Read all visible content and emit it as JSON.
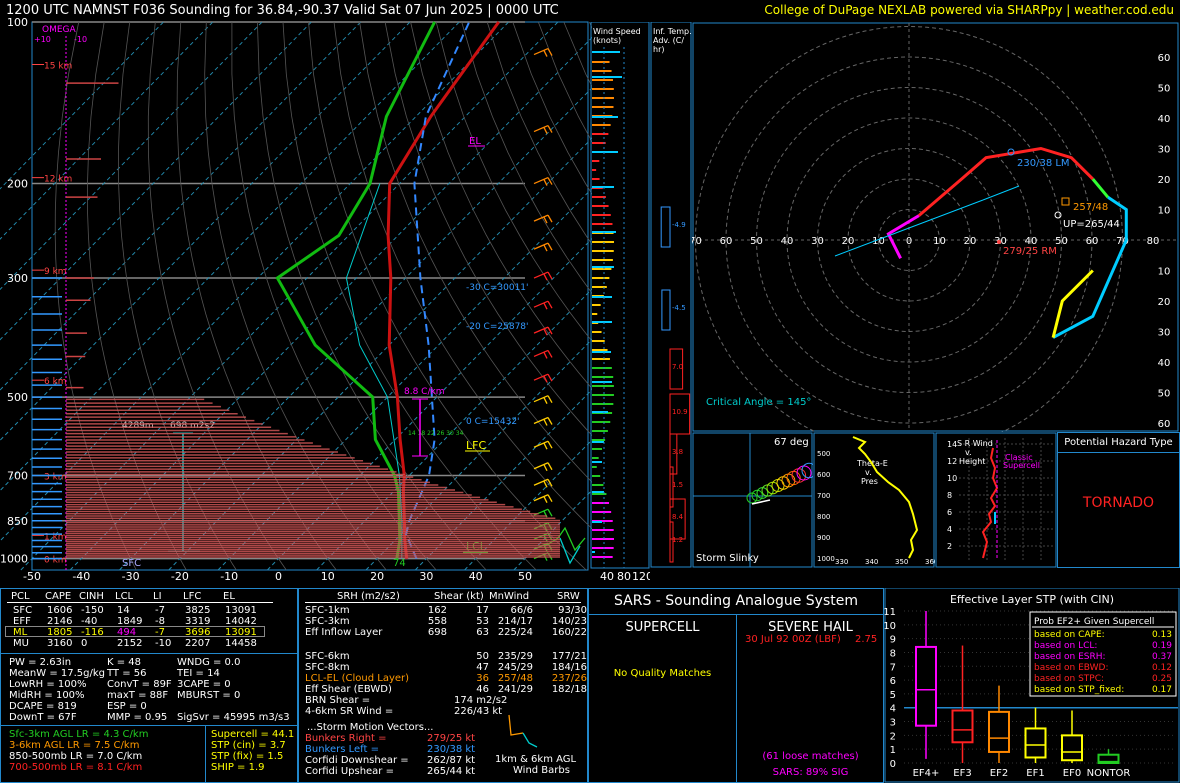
{
  "header": {
    "title": "1200 UTC NAMNST F036 Sounding for 36.84,-90.37 Valid  Sat 07 Jun 2025 | 0000 UTC",
    "credit": "College of DuPage NEXLAB powered via SHARPpy | weather.cod.edu"
  },
  "colors": {
    "accent": "#2288cc",
    "temp": "#cc1111",
    "dewpoint": "#11bb11",
    "parcel": "#3388ff",
    "highlight": "#ffff00",
    "magenta": "#ff00ff"
  },
  "chart_data": [
    {
      "type": "line",
      "name": "skewt",
      "pressure_ticks": [
        "100",
        "200",
        "300",
        "500",
        "700",
        "850",
        "1000"
      ],
      "temp_ticks": [
        "-50",
        "-40",
        "-30",
        "-20",
        "-10",
        "0",
        "10",
        "20",
        "30",
        "40",
        "50"
      ],
      "height_labels": [
        "15 km",
        "12 km",
        "9 km",
        "6 km",
        "3 km",
        "1 km",
        "0 km"
      ],
      "omega_label": "OMEGA",
      "omega_ticks": [
        "+10",
        "-10"
      ],
      "annotations": [
        "EL",
        "LFC",
        "LCL",
        "SFC",
        "74",
        "-30 C=30011'",
        "-20 C=25878'",
        "0 C=15432'",
        "8.8 C/km",
        "4289m",
        "698 m2s2",
        "14  18  22 26 30 34"
      ],
      "series": [
        {
          "name": "Temperature",
          "points": [
            [
              1000,
              26
            ],
            [
              925,
              22
            ],
            [
              850,
              18
            ],
            [
              750,
              12
            ],
            [
              700,
              9
            ],
            [
              600,
              1
            ],
            [
              500,
              -8
            ],
            [
              400,
              -20
            ],
            [
              300,
              -33
            ],
            [
              250,
              -42
            ],
            [
              200,
              -52
            ],
            [
              150,
              -57
            ],
            [
              100,
              -62
            ]
          ]
        },
        {
          "name": "Dewpoint",
          "points": [
            [
              1000,
              24
            ],
            [
              925,
              21
            ],
            [
              850,
              17
            ],
            [
              750,
              11
            ],
            [
              700,
              7
            ],
            [
              600,
              -4
            ],
            [
              500,
              -13
            ],
            [
              400,
              -35
            ],
            [
              300,
              -56
            ],
            [
              250,
              -52
            ],
            [
              200,
              -56
            ],
            [
              150,
              -66
            ],
            [
              100,
              -75
            ]
          ]
        },
        {
          "name": "Parcel",
          "points": [
            [
              1000,
              28
            ],
            [
              900,
              21
            ],
            [
              850,
              19
            ],
            [
              700,
              14
            ],
            [
              600,
              8
            ],
            [
              500,
              -1
            ],
            [
              400,
              -12
            ],
            [
              300,
              -27
            ],
            [
              200,
              -47
            ],
            [
              150,
              -58
            ],
            [
              100,
              -68
            ]
          ]
        }
      ]
    },
    {
      "type": "line",
      "name": "hodograph",
      "rings": [
        "10",
        "20",
        "30",
        "40",
        "50",
        "60",
        "70"
      ],
      "x_ticks": [
        "70",
        "60",
        "50",
        "40",
        "30",
        "20",
        "10",
        "0",
        "10",
        "20",
        "30",
        "40",
        "50",
        "60",
        "70",
        "80"
      ],
      "y_ticks": [
        "60",
        "50",
        "40",
        "30",
        "20",
        "10",
        "0",
        "10",
        "20",
        "30",
        "40",
        "50",
        "60"
      ],
      "labels": {
        "lm": "230/38 LM",
        "rm": "279/25 RM",
        "up": "UP=265/44",
        "cm": "257/48",
        "critical": "Critical Angle = 145°"
      },
      "segments": [
        {
          "color": "#ff00ff",
          "points": [
            [
              -8,
              -6
            ],
            [
              -12,
              2
            ],
            [
              -2,
              8
            ]
          ]
        },
        {
          "color": "#ff2222",
          "points": [
            [
              -2,
              8
            ],
            [
              12,
              20
            ],
            [
              20,
              27
            ],
            [
              38,
              30
            ],
            [
              48,
              27
            ],
            [
              55,
              20
            ]
          ]
        },
        {
          "color": "#33ff33",
          "points": [
            [
              55,
              20
            ],
            [
              60,
              14
            ]
          ]
        },
        {
          "color": "#00ccff",
          "points": [
            [
              60,
              14
            ],
            [
              66,
              10
            ],
            [
              66,
              0
            ],
            [
              55,
              -25
            ],
            [
              42,
              -32
            ]
          ]
        },
        {
          "color": "#ffff00",
          "points": [
            [
              42,
              -32
            ],
            [
              45,
              -20
            ],
            [
              55,
              -10
            ]
          ]
        }
      ]
    }
  ],
  "wind_speed": {
    "title1": "Wind Speed",
    "title2": "(knots)",
    "ticks": [
      "40",
      "80",
      "120"
    ]
  },
  "temp_adv": {
    "title1": "Inf. Temp.",
    "title2": "Adv. (C/",
    "title3": "hr)",
    "values": [
      "-4.9",
      "-4.5",
      "7.0",
      "10.9",
      "3.8",
      "1.5",
      "8.4",
      "1.2"
    ]
  },
  "slinky": {
    "label": "67 deg",
    "title": "Storm Slinky"
  },
  "theta": {
    "title1": "Theta-E",
    "title2": "v.",
    "title3": "Pres",
    "y_ticks": [
      "500",
      "600",
      "700",
      "800",
      "900",
      "1000"
    ],
    "x_ticks": [
      "330",
      "340",
      "350",
      "360"
    ]
  },
  "srwind": {
    "title1": "S R Wind",
    "title2": "v.",
    "title3": "Height",
    "y_ticks": [
      "14",
      "12",
      "10",
      "8",
      "6",
      "4",
      "2"
    ],
    "note1": "Classic",
    "note2": "Supercell"
  },
  "hazard": {
    "title": "Potential Hazard Type",
    "value": "TORNADO"
  },
  "parcels": {
    "headers": [
      "PCL",
      "CAPE",
      "CINH",
      "LCL",
      "LI",
      "LFC",
      "EL"
    ],
    "rows": [
      [
        "SFC",
        "1606",
        "-150",
        "14",
        "-7",
        "3825",
        "13091"
      ],
      [
        "EFF",
        "2146",
        "-40",
        "1849",
        "-8",
        "3319",
        "14042"
      ],
      [
        "ML",
        "1805",
        "-116",
        "494",
        "-7",
        "3696",
        "13091"
      ],
      [
        "MU",
        "3160",
        "0",
        "2152",
        "-10",
        "2207",
        "14458"
      ]
    ],
    "misc": [
      [
        "PW = 2.63in",
        "K = 48",
        "WNDG = 0.0"
      ],
      [
        "MeanW = 17.5g/kg",
        "TT = 56",
        "TEI = 14"
      ],
      [
        "LowRH = 100%",
        "ConvT = 89F",
        "3CAPE = 0"
      ],
      [
        "MidRH = 100%",
        "maxT = 88F",
        "MBURST = 0"
      ],
      [
        "DCAPE = 819",
        "ESP = 0",
        ""
      ],
      [
        "DownT = 67F",
        "MMP = 0.95",
        "SigSvr = 45995 m3/s3"
      ]
    ],
    "lapse": [
      "Sfc-3km AGL LR = 4.3 C/km",
      "3-6km AGL LR = 7.5 C/km",
      "850-500mb LR = 7.0 C/km",
      "700-500mb LR = 8.1 C/km"
    ],
    "indices": [
      "Supercell = 44.1",
      "STP (cin) = 3.7",
      "STP (fix) = 1.5",
      "SHIP = 1.9"
    ]
  },
  "kinematics": {
    "headers": [
      "SRH (m2/s2)",
      "Shear (kt)",
      "MnWind",
      "SRW"
    ],
    "rows": [
      [
        "SFC-1km",
        "162",
        "17",
        "66/6",
        "93/30"
      ],
      [
        "SFC-3km",
        "558",
        "53",
        "214/17",
        "140/23"
      ],
      [
        "Eff Inflow Layer",
        "698",
        "63",
        "225/24",
        "160/22"
      ],
      [
        "",
        "",
        "",
        "",
        ""
      ],
      [
        "SFC-6km",
        "50",
        "235/29",
        "177/21",
        ""
      ],
      [
        "SFC-8km",
        "47",
        "245/29",
        "184/16",
        ""
      ],
      [
        "LCL-EL (Cloud Layer)",
        "36",
        "257/48",
        "237/26",
        ""
      ],
      [
        "Eff Shear (EBWD)",
        "46",
        "241/29",
        "182/18",
        ""
      ]
    ],
    "brn": [
      "BRN Shear =",
      "174 m2/s2"
    ],
    "sr46": [
      "4-6km SR Wind =",
      "226/43 kt"
    ],
    "storm_title": "...Storm Motion Vectors...",
    "storm": [
      [
        "Bunkers Right =",
        "279/25 kt"
      ],
      [
        "Bunkers Left =",
        "230/38 kt"
      ],
      [
        "Corfidi Downshear =",
        "262/87 kt"
      ],
      [
        "Corfidi Upshear =",
        "265/44 kt"
      ]
    ],
    "barbs_label1": "1km & 6km AGL",
    "barbs_label2": "Wind Barbs"
  },
  "sars": {
    "title": "SARS - Sounding Analogue System",
    "supercell": "SUPERCELL",
    "hail": "SEVERE HAIL",
    "no_match": "No Quality Matches",
    "hail_match": "30 Jul 92 00Z (LBF)",
    "hail_size": "2.75",
    "loose": "(61 loose matches)",
    "sig": "SARS: 89% SIG"
  },
  "stp": {
    "title": "Effective Layer STP (with CIN)",
    "y_ticks": [
      "11",
      "10",
      "9",
      "8",
      "7",
      "6",
      "5",
      "4",
      "3",
      "2",
      "1",
      "0"
    ],
    "categories": [
      "EF4+",
      "EF3",
      "EF2",
      "EF1",
      "EF0",
      "NONTOR"
    ],
    "box_colors": [
      "#ff00ff",
      "#ff2222",
      "#ff8800",
      "#ffff00",
      "#ffff00",
      "#22cc22"
    ],
    "boxes": [
      {
        "lo": 0.3,
        "q1": 2.7,
        "med": 5.3,
        "q3": 8.4,
        "hi": 11.0
      },
      {
        "lo": 0.0,
        "q1": 1.5,
        "med": 2.4,
        "q3": 3.8,
        "hi": 8.5
      },
      {
        "lo": 0.0,
        "q1": 0.8,
        "med": 1.8,
        "q3": 3.7,
        "hi": 5.6
      },
      {
        "lo": 0.0,
        "q1": 0.4,
        "med": 1.3,
        "q3": 2.5,
        "hi": 4.0
      },
      {
        "lo": 0.0,
        "q1": 0.2,
        "med": 0.8,
        "q3": 2.0,
        "hi": 3.8
      },
      {
        "lo": 0.0,
        "q1": 0.0,
        "med": 0.1,
        "q3": 0.6,
        "hi": 1.0
      }
    ],
    "prob_title": "Prob EF2+ Given Supercell",
    "probs": [
      {
        "label": "based on CAPE:",
        "value": "0.13",
        "color": "#ffff00"
      },
      {
        "label": "based on LCL:",
        "value": "0.19",
        "color": "#ff00ff"
      },
      {
        "label": "based on ESRH:",
        "value": "0.37",
        "color": "#ff00ff"
      },
      {
        "label": "based on EBWD:",
        "value": "0.12",
        "color": "#ff2222"
      },
      {
        "label": "based on STPC:",
        "value": "0.25",
        "color": "#ff2222"
      },
      {
        "label": "based on STP_fixed:",
        "value": "0.17",
        "color": "#ffff00"
      }
    ]
  }
}
